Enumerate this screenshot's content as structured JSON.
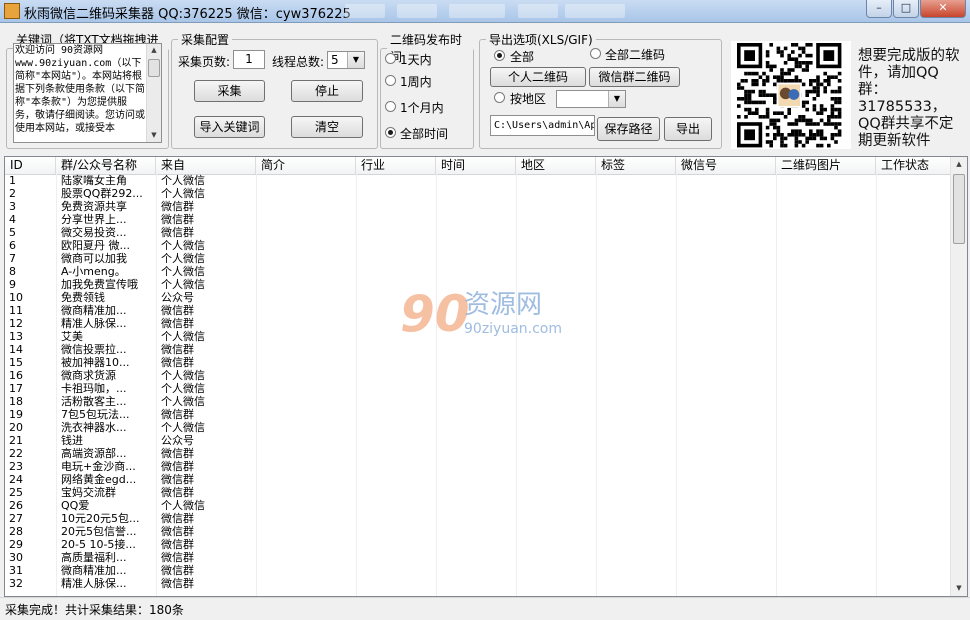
{
  "window": {
    "title": "秋雨微信二维码采集器 QQ:376225  微信：cyw376225",
    "minimize": "–",
    "maximize": "□",
    "close": "✕"
  },
  "keywords": {
    "legend": "关键词（将TXT文档拖拽进来）",
    "text": "欢迎访问 90资源网\nwww.90ziyuan.com（以下简称\"本网站\"）。本网站将根据下列条款使用条款（以下简称\"本条款\"）为您提供服务，敬请仔细阅读。您访问或使用本网站，或接受本"
  },
  "config": {
    "legend": "采集配置",
    "pages_label": "采集页数:",
    "pages_value": "1",
    "threads_label": "线程总数:",
    "threads_value": "5",
    "collect": "采集",
    "stop": "停止",
    "import": "导入关键词",
    "clear": "清空"
  },
  "time": {
    "legend": "二维码发布时间",
    "options": [
      "1天内",
      "1周内",
      "1个月内",
      "全部时间"
    ],
    "selected": 3
  },
  "export": {
    "legend": "导出选项(XLS/GIF)",
    "all": "全部",
    "all_qr": "全部二维码",
    "personal_qr": "个人二维码",
    "group_qr": "微信群二维码",
    "by_region": "按地区",
    "path": "C:\\Users\\admin\\Ap",
    "save_path": "保存路径",
    "export": "导出"
  },
  "promo": {
    "text": "想要完成版的软件，请加QQ群：31785533，QQ群共享不定期更新软件"
  },
  "table": {
    "columns": [
      "ID",
      "群/公众号名称",
      "来自",
      "简介",
      "行业",
      "时间",
      "地区",
      "标签",
      "微信号",
      "二维码图片",
      "工作状态"
    ],
    "rows": [
      [
        "1",
        "陆家嘴女主角",
        "个人微信"
      ],
      [
        "2",
        "股票QQ群292...",
        "个人微信"
      ],
      [
        "3",
        "免费资源共享",
        "微信群"
      ],
      [
        "4",
        "分享世界上...",
        "微信群"
      ],
      [
        "5",
        "微交易投资...",
        "微信群"
      ],
      [
        "6",
        "欧阳夏丹 微...",
        "个人微信"
      ],
      [
        "7",
        "微商可以加我",
        "个人微信"
      ],
      [
        "8",
        "A-小meng。",
        "个人微信"
      ],
      [
        "9",
        "加我免费宣传哦",
        "个人微信"
      ],
      [
        "10",
        "免费领钱",
        "公众号"
      ],
      [
        "11",
        "微商精准加...",
        "微信群"
      ],
      [
        "12",
        "精准人脉保...",
        "微信群"
      ],
      [
        "13",
        "艾美",
        "个人微信"
      ],
      [
        "14",
        "微信投票拉...",
        "微信群"
      ],
      [
        "15",
        "被加神器10...",
        "微信群"
      ],
      [
        "16",
        "微商求货源",
        "个人微信"
      ],
      [
        "17",
        "卡祖玛咖，...",
        "个人微信"
      ],
      [
        "18",
        "活粉散客主...",
        "个人微信"
      ],
      [
        "19",
        "7包5包玩法...",
        "微信群"
      ],
      [
        "20",
        "洗衣神器水...",
        "个人微信"
      ],
      [
        "21",
        "钱进",
        "公众号"
      ],
      [
        "22",
        "高端资源部...",
        "微信群"
      ],
      [
        "23",
        "电玩+金沙商...",
        "微信群"
      ],
      [
        "24",
        "网络黄金egd...",
        "微信群"
      ],
      [
        "25",
        "宝妈交流群",
        "微信群"
      ],
      [
        "26",
        "QQ爱",
        "个人微信"
      ],
      [
        "27",
        "10元20元5包...",
        "微信群"
      ],
      [
        "28",
        "20元5包信誉...",
        "微信群"
      ],
      [
        "29",
        "20-5 10-5接...",
        "微信群"
      ],
      [
        "30",
        "高质量福利...",
        "微信群"
      ],
      [
        "31",
        "微商精准加...",
        "微信群"
      ],
      [
        "32",
        "精准人脉保...",
        "微信群"
      ]
    ]
  },
  "watermark": {
    "brand": "资源网",
    "url": "90ziyuan.com"
  },
  "status": {
    "text": "采集完成！共计采集结果：180条"
  }
}
